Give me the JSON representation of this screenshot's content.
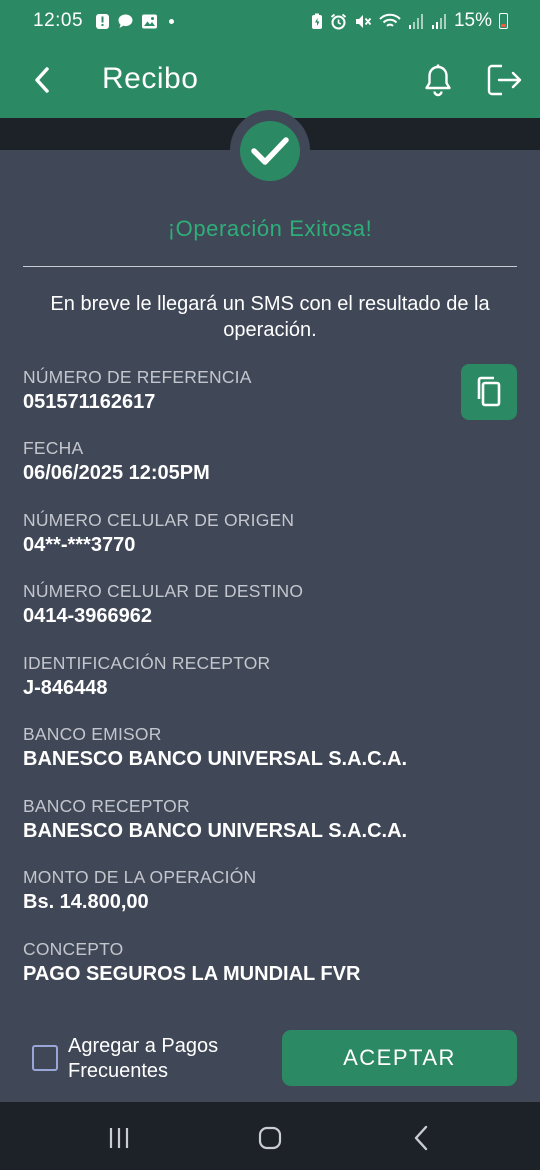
{
  "status_bar": {
    "time": "12:05",
    "battery": "15%",
    "icons": [
      "alert-icon",
      "chat-icon",
      "image-icon",
      "dot-icon",
      "battery-saver-icon",
      "alarm-icon",
      "mute-icon",
      "wifi-icon",
      "signal-icon",
      "signal-icon",
      "battery-icon"
    ]
  },
  "app_bar": {
    "title": "Recibo",
    "icons": [
      "back-arrow-icon",
      "bell-icon",
      "logout-icon"
    ]
  },
  "receipt": {
    "success_title": "¡Operación Exitosa!",
    "sms_notice": "En breve le llegará un SMS con el resultado de la operación.",
    "fields": [
      {
        "label": "NÚMERO DE REFERENCIA",
        "value": "051571162617"
      },
      {
        "label": "FECHA",
        "value": "06/06/2025 12:05PM"
      },
      {
        "label": "NÚMERO CELULAR DE ORIGEN",
        "value": "04**-***3770"
      },
      {
        "label": "NÚMERO CELULAR DE DESTINO",
        "value": "0414-3966962"
      },
      {
        "label": "IDENTIFICACIÓN RECEPTOR",
        "value": "J-846448"
      },
      {
        "label": "BANCO EMISOR",
        "value": "BANESCO BANCO UNIVERSAL S.A.C.A."
      },
      {
        "label": "BANCO RECEPTOR",
        "value": "BANESCO BANCO UNIVERSAL S.A.C.A."
      },
      {
        "label": "MONTO DE LA OPERACIÓN",
        "value": "Bs. 14.800,00"
      },
      {
        "label": "CONCEPTO",
        "value": "PAGO SEGUROS LA MUNDIAL FVR"
      }
    ]
  },
  "footer": {
    "frequent_payments_line1": "Agregar a Pagos",
    "frequent_payments_line2": "Frecuentes",
    "frequent_payments_checked": false,
    "accept_label": "ACEPTAR"
  },
  "nav_bar": {
    "icons": [
      "recent-apps-icon",
      "home-icon",
      "back-icon"
    ]
  },
  "colors": {
    "brand_green": "#2b8a63",
    "success_text": "#2fae79",
    "background": "#404756",
    "dark_strip": "#1d2128"
  }
}
